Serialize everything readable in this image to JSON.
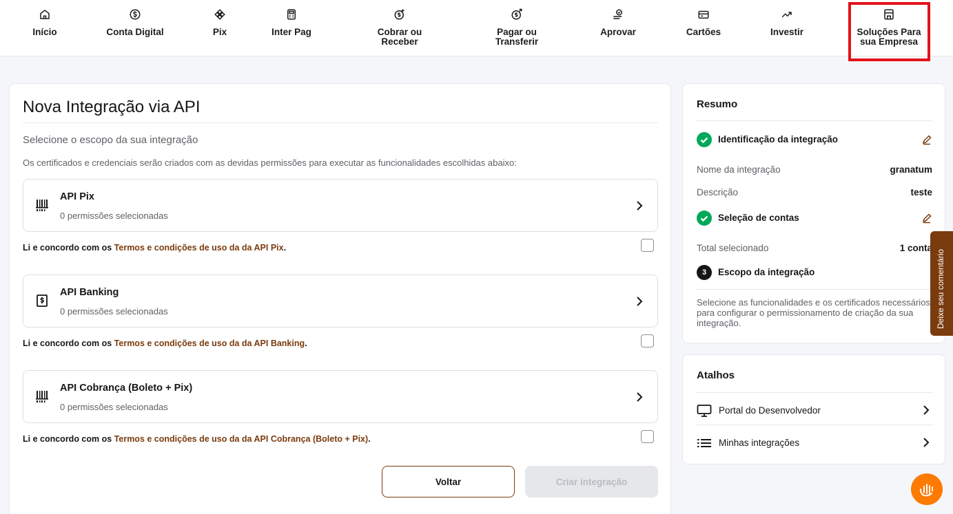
{
  "nav": {
    "items": [
      {
        "label": "Início",
        "icon": "home-icon"
      },
      {
        "label": "Conta Digital",
        "icon": "dollar-circle-icon"
      },
      {
        "label": "Pix",
        "icon": "pix-icon"
      },
      {
        "label": "Inter Pag",
        "icon": "pos-terminal-icon"
      },
      {
        "label": "Cobrar ou\nReceber",
        "icon": "receive-money-icon"
      },
      {
        "label": "Pagar ou\nTransferir",
        "icon": "send-money-icon"
      },
      {
        "label": "Aprovar",
        "icon": "approve-list-icon"
      },
      {
        "label": "Cartões",
        "icon": "card-icon"
      },
      {
        "label": "Investir",
        "icon": "trend-up-icon"
      },
      {
        "label": "Soluções Para\nsua Empresa",
        "icon": "store-icon"
      }
    ]
  },
  "main": {
    "title": "Nova Integração via API",
    "subtitle": "Selecione o escopo da sua integração",
    "description": "Os certificados e credenciais serão criados com as devidas permissões para executar as funcionalidades escolhidas abaixo:",
    "apis": [
      {
        "name": "API Pix",
        "permissions": "0 permissões selecionadas",
        "icon": "barcode-icon",
        "terms_prefix": "Li e concordo com os ",
        "terms_link": "Termos e condições de uso da da API Pix",
        "terms_suffix": "."
      },
      {
        "name": "API Banking",
        "permissions": "0 permissões selecionadas",
        "icon": "bank-receipt-icon",
        "terms_prefix": "Li e concordo com os ",
        "terms_link": "Termos e condições de uso da da API Banking",
        "terms_suffix": "."
      },
      {
        "name": "API Cobrança (Boleto + Pix)",
        "permissions": "0 permissões selecionadas",
        "icon": "barcode-icon",
        "terms_prefix": "Li e concordo com os ",
        "terms_link": "Termos e condições de uso da da API Cobrança (Boleto + Pix)",
        "terms_suffix": "."
      }
    ],
    "back_label": "Voltar",
    "create_label": "Criar integração"
  },
  "resumo": {
    "title": "Resumo",
    "step1_label": "Identificação da integração",
    "name_key": "Nome da integração",
    "name_value": "granatum",
    "desc_key": "Descrição",
    "desc_value": "teste",
    "step2_label": "Seleção de contas",
    "total_key": "Total selecionado",
    "total_value": "1 conta",
    "step3_number": "3",
    "step3_label": "Escopo da integração",
    "step3_help": "Selecione as funcionalidades e os certificados necessários para configurar o permissionamento de criação da sua integração."
  },
  "atalhos": {
    "title": "Atalhos",
    "items": [
      {
        "label": "Portal do Desenvolvedor",
        "icon": "monitor-icon"
      },
      {
        "label": "Minhas integrações",
        "icon": "list-icon"
      }
    ]
  },
  "feedback": {
    "label": "Deixe seu comentário"
  },
  "colors": {
    "brand": "#7a3b0e",
    "success": "#00a85a",
    "chat": "#ff7a00",
    "highlight": "#e3121b"
  }
}
